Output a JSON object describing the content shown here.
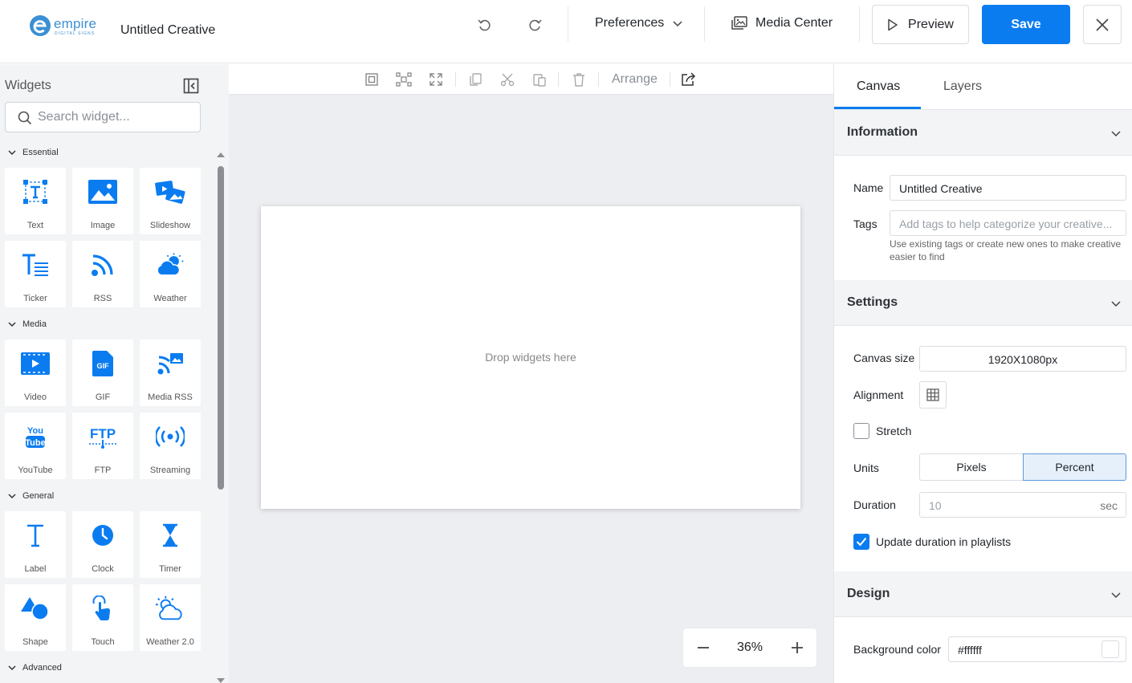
{
  "header": {
    "logo_text": "empire",
    "logo_sub": "DIGITAL SIGNS",
    "title": "Untitled Creative",
    "preferences_label": "Preferences",
    "media_center_label": "Media Center",
    "preview_label": "Preview",
    "save_label": "Save"
  },
  "sidebar": {
    "title": "Widgets",
    "search_placeholder": "Search widget...",
    "categories": [
      {
        "label": "Essential",
        "widgets": [
          "Text",
          "Image",
          "Slideshow",
          "Ticker",
          "RSS",
          "Weather"
        ]
      },
      {
        "label": "Media",
        "widgets": [
          "Video",
          "GIF",
          "Media RSS",
          "YouTube",
          "FTP",
          "Streaming"
        ]
      },
      {
        "label": "General",
        "widgets": [
          "Label",
          "Clock",
          "Timer",
          "Shape",
          "Touch",
          "Weather 2.0"
        ]
      },
      {
        "label": "Advanced",
        "widgets": []
      }
    ]
  },
  "toolbar": {
    "arrange_label": "Arrange"
  },
  "canvas": {
    "drop_text": "Drop widgets here",
    "zoom": "36%"
  },
  "right_panel": {
    "tabs": [
      "Canvas",
      "Layers"
    ],
    "information": {
      "title": "Information",
      "name_label": "Name",
      "name_value": "Untitled Creative",
      "tags_label": "Tags",
      "tags_placeholder": "Add tags to help categorize your creative...",
      "tags_hint": "Use existing tags or create new ones to make creative easier to find"
    },
    "settings": {
      "title": "Settings",
      "canvas_size_label": "Canvas size",
      "canvas_size_value": "1920X1080px",
      "alignment_label": "Alignment",
      "stretch_label": "Stretch",
      "stretch_checked": false,
      "units_label": "Units",
      "units_options": [
        "Pixels",
        "Percent"
      ],
      "units_selected": "Percent",
      "duration_label": "Duration",
      "duration_placeholder": "10",
      "duration_unit": "sec",
      "update_duration_label": "Update duration in playlists",
      "update_duration_checked": true
    },
    "design": {
      "title": "Design",
      "bg_color_label": "Background color",
      "bg_color_value": "#ffffff"
    }
  },
  "colors": {
    "accent": "#0b7cf0",
    "icon_blue": "#0b7cf0"
  }
}
